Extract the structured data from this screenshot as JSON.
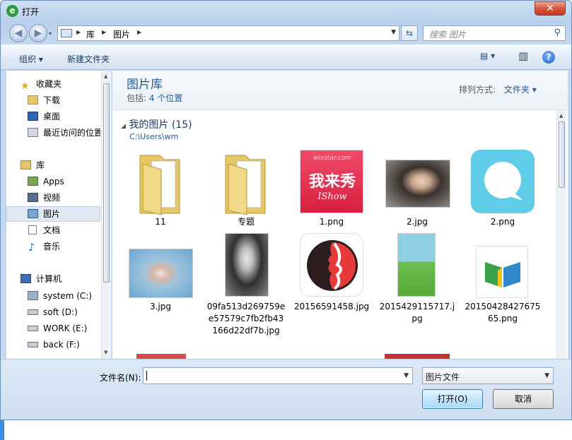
{
  "window": {
    "title": "打开",
    "title_icon": "e",
    "close_glyph": "✕"
  },
  "nav": {
    "back_glyph": "◀",
    "forward_glyph": "▶",
    "history_glyph": "▾",
    "breadcrumb": [
      "库",
      "图片"
    ],
    "refresh_glyph": "⇆",
    "search_placeholder": "搜索 图片",
    "search_glyph": "⚲"
  },
  "toolbar": {
    "organize": "组织 ▾",
    "new_folder": "新建文件夹",
    "view_glyph": "▤ ▾",
    "preview_glyph": "▥",
    "help_glyph": "?"
  },
  "sidebar": {
    "items": [
      {
        "label": "收藏夹",
        "icon": "star-icon"
      },
      {
        "label": "下载",
        "icon": "download-folder-icon"
      },
      {
        "label": "桌面",
        "icon": "desktop-icon"
      },
      {
        "label": "最近访问的位置",
        "icon": "recent-places-icon"
      },
      {
        "label": "库",
        "icon": "library-icon"
      },
      {
        "label": "Apps",
        "icon": "apps-icon"
      },
      {
        "label": "视频",
        "icon": "video-icon"
      },
      {
        "label": "图片",
        "icon": "pictures-icon",
        "selected": true
      },
      {
        "label": "文档",
        "icon": "documents-icon"
      },
      {
        "label": "音乐",
        "icon": "music-icon"
      },
      {
        "label": "计算机",
        "icon": "computer-icon"
      },
      {
        "label": "system (C:)",
        "icon": "system-drive-icon"
      },
      {
        "label": "soft (D:)",
        "icon": "drive-icon"
      },
      {
        "label": "WORK (E:)",
        "icon": "drive-icon"
      },
      {
        "label": "back (F:)",
        "icon": "drive-icon"
      }
    ]
  },
  "library": {
    "title": "图片库",
    "includes_label": "包括:",
    "includes_link": "4 个位置",
    "arrange_label": "排列方式:",
    "arrange_value": "文件夹 ▾",
    "group_title": "我的图片 (15)",
    "group_path": "C:\\Users\\wm",
    "files": [
      {
        "name": "11",
        "kind": "folder"
      },
      {
        "name": "专题",
        "kind": "folder"
      },
      {
        "name": "1.png",
        "kind": "logo-red",
        "thumb_title": "我来秀",
        "thumb_sub": "IShow",
        "thumb_top": "wixstar.com"
      },
      {
        "name": "2.jpg",
        "kind": "photo-dark"
      },
      {
        "name": "2.png",
        "kind": "chat-icon"
      },
      {
        "name": "3.jpg",
        "kind": "photo-blue"
      },
      {
        "name": "09fa513d269759ee57579c7fb2fb43166d22df7b.jpg",
        "kind": "photo-bw"
      },
      {
        "name": "20156591458.jpg",
        "kind": "profile-logo"
      },
      {
        "name": "2015429115717.jpg",
        "kind": "green-poster"
      },
      {
        "name": "20150428427675 65.png",
        "kind": "book-logo"
      }
    ]
  },
  "bottom": {
    "filename_label": "文件名(N):",
    "filename_value": "",
    "filter_value": "图片文件",
    "open_label": "打开(O)",
    "cancel_label": "取消"
  },
  "colors": {
    "accent": "#1e5a9c",
    "selection": "#dfe8f3",
    "close": "#d9533c"
  }
}
